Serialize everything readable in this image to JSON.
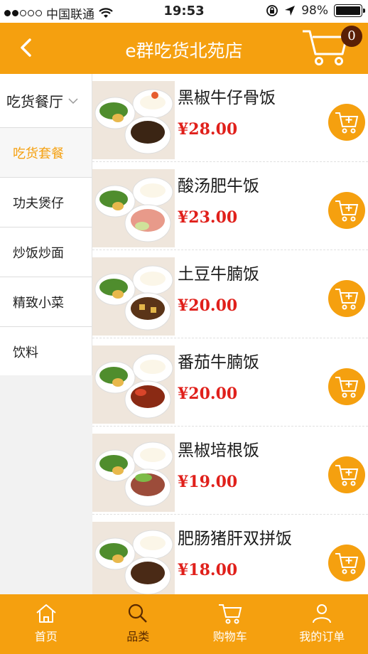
{
  "status_bar": {
    "carrier": "中国联通",
    "time": "19:53",
    "battery": "98%"
  },
  "header": {
    "title": "e群吃货北苑店",
    "cart_count": "0",
    "icons": [
      "back-icon",
      "cart-icon"
    ]
  },
  "sidebar": {
    "top_category": "吃货餐厅",
    "categories": [
      "吃货套餐",
      "功夫煲仔",
      "炒饭炒面",
      "精致小菜",
      "饮料"
    ],
    "active_index": 0
  },
  "products": [
    {
      "name": "黑椒牛仔骨饭",
      "price": "¥28.00"
    },
    {
      "name": "酸汤肥牛饭",
      "price": "¥23.00"
    },
    {
      "name": "土豆牛腩饭",
      "price": "¥20.00"
    },
    {
      "name": "番茄牛腩饭",
      "price": "¥20.00"
    },
    {
      "name": "黑椒培根饭",
      "price": "¥19.00"
    },
    {
      "name": "肥肠猪肝双拼饭",
      "price": "¥18.00"
    }
  ],
  "tabbar": {
    "tabs": [
      {
        "label": "首页",
        "icon": "home-icon"
      },
      {
        "label": "品类",
        "icon": "search-icon"
      },
      {
        "label": "购物车",
        "icon": "cart-icon"
      },
      {
        "label": "我的订单",
        "icon": "user-icon"
      }
    ],
    "active_index": 1
  },
  "colors": {
    "accent": "#f5a00f",
    "price": "#e0201b",
    "badge": "#5a1f05"
  }
}
